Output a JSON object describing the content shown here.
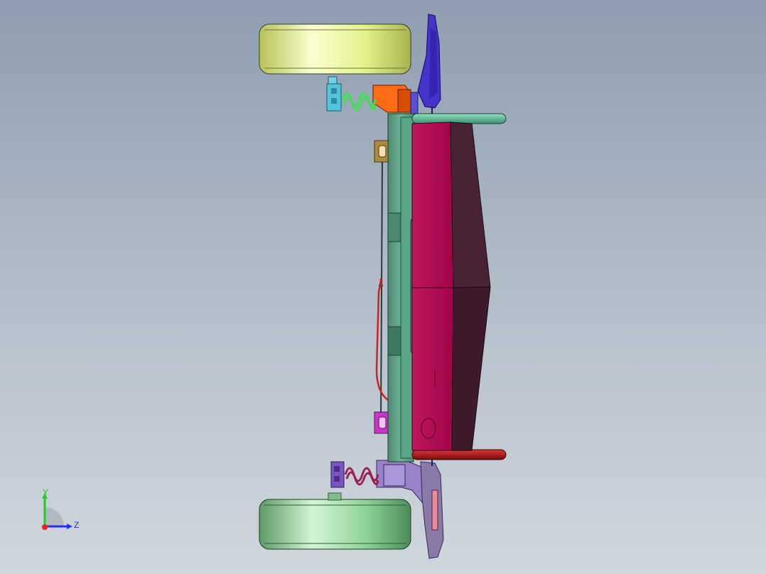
{
  "viewport": {
    "background_top": "#8e9db0",
    "background_bottom": "#d0d6dd"
  },
  "triad": {
    "y_label": "Y",
    "z_label": "Z",
    "y_color": "#22cc22",
    "z_color": "#2233ee",
    "x_color": "#ee2222"
  },
  "colors": {
    "wheel_top": "#e6f08c",
    "wheel_bottom": "#8fd49a",
    "front_wing": "#4433cc",
    "rear_wing": "#8a7aa8",
    "upper_bracket": "#ff6a14",
    "lower_bracket": "#9a82c8",
    "spring_top": "#44dd55",
    "spring_bottom": "#992255",
    "chassis_plate": "#5a9b82",
    "body_panel": "#b3064f",
    "body_shadow": "#4a2236",
    "top_rod": "#58b896",
    "bottom_rod": "#a41a1a",
    "mount_top": "#b08a3c",
    "mount_bottom": "#cc33cc",
    "cable": "#cc2222"
  }
}
